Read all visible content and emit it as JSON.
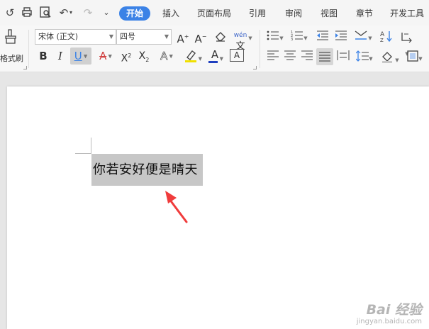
{
  "quick_access": {
    "icons": [
      "undo-history-icon",
      "print-icon",
      "print-preview-icon",
      "undo-icon",
      "redo-icon",
      "customize-icon"
    ]
  },
  "tabs": [
    {
      "label": "开始",
      "active": true
    },
    {
      "label": "插入"
    },
    {
      "label": "页面布局"
    },
    {
      "label": "引用"
    },
    {
      "label": "审阅"
    },
    {
      "label": "视图"
    },
    {
      "label": "章节"
    },
    {
      "label": "开发工具"
    }
  ],
  "ribbon": {
    "format_painter_label": "格式刷",
    "font_name": "宋体 (正文)",
    "font_size": "四号",
    "bold": "B",
    "italic": "I",
    "underline": "U",
    "strike": "A",
    "superscript": "X",
    "superscript_mark": "2",
    "subscript": "X",
    "subscript_mark": "2",
    "text_effect": "A",
    "highlight": "A",
    "font_color": "A",
    "char_border": "A",
    "grow_font": "A",
    "shrink_font": "A",
    "pinyin": "wén",
    "accent_color": "#3b82e6",
    "font_color_bar": "#1f3fbf",
    "highlight_bar": "#f0e000"
  },
  "document": {
    "selected_text": "你若安好便是晴天"
  },
  "annotation": {
    "arrow_color": "#f03c3c"
  },
  "watermark": {
    "logo": "Bai 经验",
    "url": "jingyan.baidu.com"
  }
}
